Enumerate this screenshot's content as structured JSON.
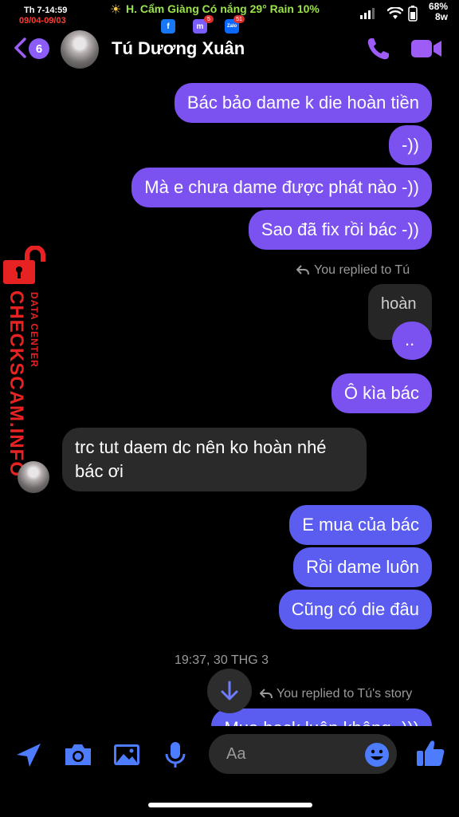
{
  "status_bar": {
    "time": "Th 7-14:59",
    "date_range": "09/04-09/03",
    "weather": "H. Cẩm Giàng Có nắng 29° Rain 10%",
    "battery_percent": "68%",
    "battery_sub": "8w",
    "app_icons": [
      {
        "name": "facebook",
        "glyph": "f",
        "badge": "",
        "color": "#1877f2"
      },
      {
        "name": "messenger",
        "glyph": "m",
        "badge": "5",
        "color": "#7b5cff"
      },
      {
        "name": "zalo",
        "glyph": "Zalo",
        "badge": "51",
        "color": "#0a68ff"
      }
    ]
  },
  "header": {
    "unread_count": "6",
    "contact_name": "Tú Dương Xuân",
    "accent_color": "#9d5cf6"
  },
  "watermark": {
    "brand": "CHECKSCAM.INFO",
    "subtitle": "DATA CENTER",
    "color": "#e62222"
  },
  "messages": [
    {
      "side": "out",
      "text": "Bác bảo dame k die hoàn tiền"
    },
    {
      "side": "out",
      "text": "-))"
    },
    {
      "side": "out",
      "text": "Mà e chưa dame được phát nào -))"
    },
    {
      "side": "out",
      "text": "Sao đã fix rồi bác -))"
    },
    {
      "side": "meta",
      "text": "You replied to Tú"
    },
    {
      "side": "quote",
      "text": "hoàn"
    },
    {
      "side": "out",
      "text": ".."
    },
    {
      "side": "out",
      "text": "Ô kìa bác"
    },
    {
      "side": "in",
      "text": "trc tut daem dc nên ko hoàn nhé bác ơi"
    },
    {
      "side": "out",
      "text": "E mua của bác"
    },
    {
      "side": "out",
      "text": "Rồi dame luôn"
    },
    {
      "side": "out",
      "text": "Cũng có die đâu"
    },
    {
      "side": "time",
      "text": "19:37, 30 THG 3"
    },
    {
      "side": "meta",
      "text": "You replied to Tú's story"
    },
    {
      "side": "out",
      "text": "Mua hack luôn không -)))"
    }
  ],
  "composer": {
    "placeholder": "Aa"
  }
}
